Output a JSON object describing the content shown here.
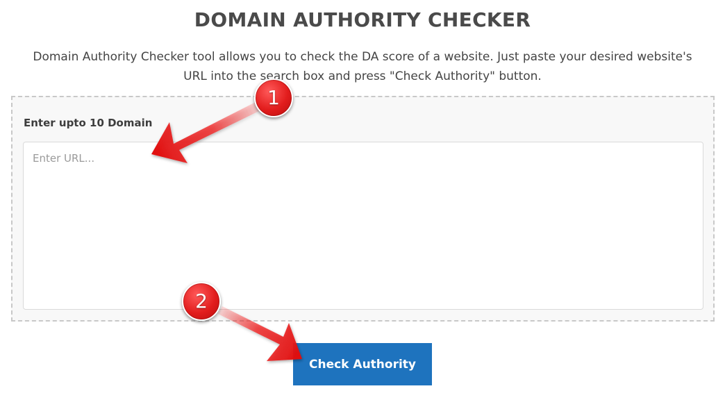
{
  "header": {
    "title": "DOMAIN AUTHORITY CHECKER",
    "description": "Domain Authority Checker tool allows you to check the DA score of a website. Just paste your desired website's URL into the search box and press \"Check Authority\" button."
  },
  "form": {
    "label": "Enter upto 10 Domain",
    "placeholder": "Enter URL...",
    "value": "",
    "submit_label": "Check Authority"
  },
  "annotations": {
    "step1": "1",
    "step2": "2"
  },
  "colors": {
    "button": "#1e73be",
    "annotation_red": "#e21d1d",
    "title": "#4a4a4a"
  },
  "icons": {
    "arrows": "red-pointer-arrow"
  }
}
